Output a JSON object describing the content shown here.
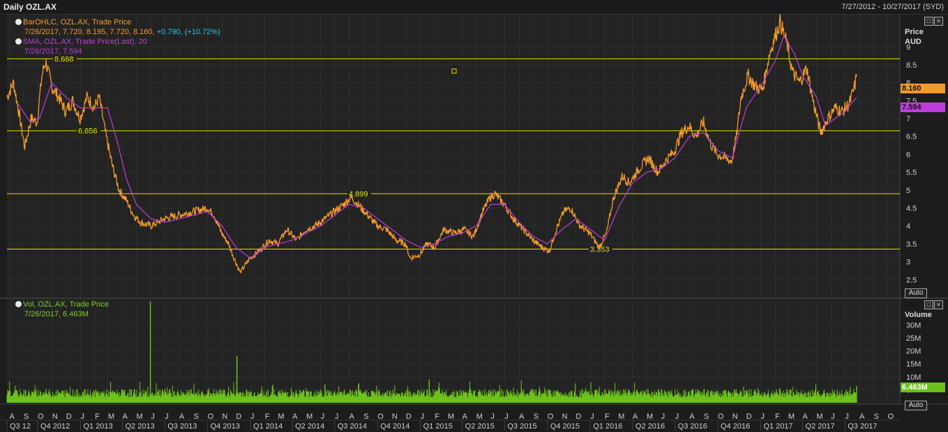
{
  "window": {
    "title": "Daily OZL.AX",
    "date_range": "7/27/2012 - 10/27/2017 (SYD)"
  },
  "price_pane": {
    "legend_bar_label": "BarOHLC, OZL.AX, Trade Price",
    "legend_bar_values": "7/26/2017, 7.720, 8.195, 7.720, 8.160,",
    "legend_bar_change": "+0.790, (+10.72%)",
    "legend_sma_label": "SMA, OZL.AX, Trade Price(Last),  20",
    "legend_sma_values": "7/26/2017, 7.594",
    "axis_title": "Price",
    "axis_unit": "AUD",
    "last_price_label": "8.160",
    "last_sma_label": "7.594",
    "auto_label": "Auto",
    "colors": {
      "price": "#f39a2b",
      "sma": "#c03cdc",
      "hline": "#e4e400",
      "price_tag": "#f39a2b",
      "sma_tag": "#c03cdc"
    }
  },
  "volume_pane": {
    "legend_label": "Vol, OZL.AX, Trade Price",
    "legend_values": "7/26/2017, 6.463M",
    "axis_title": "Volume",
    "last_volume_label": "6.463M",
    "auto_label": "Auto",
    "colors": {
      "volume": "#6cc21b",
      "volume_tag": "#6cc21b"
    }
  },
  "chart_data": [
    {
      "type": "line",
      "y_unit": "AUD",
      "ylim": [
        2.0,
        9.9
      ],
      "y_ticks": [
        "2.5",
        "3",
        "3.5",
        "4",
        "4.5",
        "5",
        "5.5",
        "6",
        "6.5",
        "7",
        "7.5",
        "8",
        "8.5",
        "9"
      ],
      "grid": true,
      "horizontal_levels": [
        {
          "value": 8.668,
          "label": "8.668"
        },
        {
          "value": 6.656,
          "label": "6.656"
        },
        {
          "value": 4.899,
          "label": "4.899"
        },
        {
          "value": 3.353,
          "label": "3.353"
        }
      ],
      "series": [
        {
          "name": "BarOHLC, OZL.AX, Trade Price",
          "points": [
            [
              "2012-07-27",
              7.6
            ],
            [
              "2012-08-10",
              8.0
            ],
            [
              "2012-08-20",
              7.3
            ],
            [
              "2012-09-03",
              6.2
            ],
            [
              "2012-09-17",
              7.0
            ],
            [
              "2012-09-30",
              6.9
            ],
            [
              "2012-10-10",
              8.2
            ],
            [
              "2012-10-18",
              8.6
            ],
            [
              "2012-10-31",
              7.9
            ],
            [
              "2012-11-15",
              7.6
            ],
            [
              "2012-11-30",
              7.2
            ],
            [
              "2012-12-15",
              7.5
            ],
            [
              "2012-12-31",
              7.0
            ],
            [
              "2013-01-15",
              7.6
            ],
            [
              "2013-01-31",
              7.3
            ],
            [
              "2013-02-10",
              7.6
            ],
            [
              "2013-02-25",
              6.5
            ],
            [
              "2013-03-10",
              5.7
            ],
            [
              "2013-03-25",
              5.0
            ],
            [
              "2013-04-10",
              4.7
            ],
            [
              "2013-04-25",
              4.3
            ],
            [
              "2013-05-10",
              4.1
            ],
            [
              "2013-06-01",
              4.0
            ],
            [
              "2013-06-30",
              4.2
            ],
            [
              "2013-07-31",
              4.3
            ],
            [
              "2013-08-31",
              4.4
            ],
            [
              "2013-09-30",
              4.5
            ],
            [
              "2013-10-15",
              4.3
            ],
            [
              "2013-10-31",
              3.8
            ],
            [
              "2013-11-15",
              3.5
            ],
            [
              "2013-11-30",
              3.0
            ],
            [
              "2013-12-10",
              2.7
            ],
            [
              "2013-12-31",
              3.1
            ],
            [
              "2014-01-20",
              3.3
            ],
            [
              "2014-02-10",
              3.6
            ],
            [
              "2014-03-01",
              3.5
            ],
            [
              "2014-03-20",
              3.9
            ],
            [
              "2014-04-10",
              3.6
            ],
            [
              "2014-04-30",
              3.9
            ],
            [
              "2014-05-20",
              4.0
            ],
            [
              "2014-06-10",
              4.2
            ],
            [
              "2014-06-30",
              4.4
            ],
            [
              "2014-07-20",
              4.6
            ],
            [
              "2014-08-05",
              4.8
            ],
            [
              "2014-08-20",
              4.6
            ],
            [
              "2014-09-10",
              4.3
            ],
            [
              "2014-09-30",
              4.0
            ],
            [
              "2014-10-20",
              3.9
            ],
            [
              "2014-11-10",
              3.6
            ],
            [
              "2014-11-30",
              3.5
            ],
            [
              "2014-12-10",
              3.1
            ],
            [
              "2014-12-31",
              3.2
            ],
            [
              "2015-01-15",
              3.5
            ],
            [
              "2015-02-01",
              3.4
            ],
            [
              "2015-02-20",
              3.9
            ],
            [
              "2015-03-15",
              3.8
            ],
            [
              "2015-04-05",
              3.9
            ],
            [
              "2015-04-25",
              3.7
            ],
            [
              "2015-05-15",
              4.4
            ],
            [
              "2015-05-31",
              4.8
            ],
            [
              "2015-06-10",
              4.9
            ],
            [
              "2015-06-30",
              4.6
            ],
            [
              "2015-07-20",
              4.2
            ],
            [
              "2015-08-10",
              3.9
            ],
            [
              "2015-08-31",
              3.6
            ],
            [
              "2015-09-20",
              3.4
            ],
            [
              "2015-10-05",
              3.3
            ],
            [
              "2015-10-20",
              3.9
            ],
            [
              "2015-11-05",
              4.4
            ],
            [
              "2015-11-20",
              4.5
            ],
            [
              "2015-12-10",
              4.0
            ],
            [
              "2015-12-31",
              3.8
            ],
            [
              "2016-01-20",
              3.4
            ],
            [
              "2016-02-05",
              3.8
            ],
            [
              "2016-02-20",
              4.8
            ],
            [
              "2016-03-10",
              5.4
            ],
            [
              "2016-03-25",
              5.2
            ],
            [
              "2016-04-15",
              5.6
            ],
            [
              "2016-05-05",
              5.9
            ],
            [
              "2016-05-25",
              5.5
            ],
            [
              "2016-06-10",
              5.8
            ],
            [
              "2016-06-30",
              6.1
            ],
            [
              "2016-07-15",
              6.6
            ],
            [
              "2016-07-31",
              6.8
            ],
            [
              "2016-08-15",
              6.5
            ],
            [
              "2016-08-31",
              6.9
            ],
            [
              "2016-09-15",
              6.3
            ],
            [
              "2016-09-30",
              6.0
            ],
            [
              "2016-10-15",
              5.9
            ],
            [
              "2016-10-31",
              5.8
            ],
            [
              "2016-11-10",
              6.5
            ],
            [
              "2016-11-20",
              7.6
            ],
            [
              "2016-12-05",
              8.2
            ],
            [
              "2016-12-20",
              7.9
            ],
            [
              "2017-01-05",
              7.8
            ],
            [
              "2017-01-20",
              8.8
            ],
            [
              "2017-02-01",
              9.3
            ],
            [
              "2017-02-12",
              9.7
            ],
            [
              "2017-02-28",
              9.0
            ],
            [
              "2017-03-10",
              8.3
            ],
            [
              "2017-03-25",
              8.0
            ],
            [
              "2017-04-10",
              8.4
            ],
            [
              "2017-04-25",
              7.4
            ],
            [
              "2017-05-10",
              6.6
            ],
            [
              "2017-05-25",
              7.0
            ],
            [
              "2017-06-10",
              7.3
            ],
            [
              "2017-06-25",
              7.2
            ],
            [
              "2017-07-10",
              7.4
            ],
            [
              "2017-07-20",
              7.8
            ],
            [
              "2017-07-26",
              8.16
            ]
          ]
        },
        {
          "name": "SMA, OZL.AX, Trade Price(Last),  20",
          "points": [
            [
              "2012-08-20",
              7.4
            ],
            [
              "2012-09-15",
              6.9
            ],
            [
              "2012-10-05",
              7.0
            ],
            [
              "2012-10-31",
              8.0
            ],
            [
              "2012-11-30",
              7.6
            ],
            [
              "2012-12-31",
              7.3
            ],
            [
              "2013-01-31",
              7.3
            ],
            [
              "2013-02-28",
              7.3
            ],
            [
              "2013-03-20",
              6.4
            ],
            [
              "2013-04-10",
              5.3
            ],
            [
              "2013-05-01",
              4.6
            ],
            [
              "2013-06-01",
              4.2
            ],
            [
              "2013-07-01",
              4.1
            ],
            [
              "2013-08-01",
              4.2
            ],
            [
              "2013-09-01",
              4.3
            ],
            [
              "2013-10-01",
              4.4
            ],
            [
              "2013-11-01",
              4.0
            ],
            [
              "2013-12-01",
              3.4
            ],
            [
              "2014-01-01",
              3.1
            ],
            [
              "2014-02-01",
              3.4
            ],
            [
              "2014-03-01",
              3.5
            ],
            [
              "2014-04-01",
              3.6
            ],
            [
              "2014-05-01",
              3.8
            ],
            [
              "2014-06-01",
              4.0
            ],
            [
              "2014-07-01",
              4.3
            ],
            [
              "2014-08-01",
              4.6
            ],
            [
              "2014-09-01",
              4.5
            ],
            [
              "2014-10-01",
              4.2
            ],
            [
              "2014-11-01",
              3.9
            ],
            [
              "2014-12-01",
              3.6
            ],
            [
              "2015-01-01",
              3.4
            ],
            [
              "2015-02-01",
              3.5
            ],
            [
              "2015-03-01",
              3.7
            ],
            [
              "2015-04-01",
              3.8
            ],
            [
              "2015-05-01",
              4.0
            ],
            [
              "2015-06-01",
              4.6
            ],
            [
              "2015-07-01",
              4.6
            ],
            [
              "2015-08-01",
              4.1
            ],
            [
              "2015-09-01",
              3.7
            ],
            [
              "2015-10-01",
              3.5
            ],
            [
              "2015-11-01",
              3.9
            ],
            [
              "2015-12-01",
              4.2
            ],
            [
              "2016-01-01",
              3.9
            ],
            [
              "2016-02-01",
              3.6
            ],
            [
              "2016-03-01",
              4.5
            ],
            [
              "2016-04-01",
              5.2
            ],
            [
              "2016-05-01",
              5.5
            ],
            [
              "2016-06-01",
              5.6
            ],
            [
              "2016-07-01",
              5.9
            ],
            [
              "2016-08-01",
              6.5
            ],
            [
              "2016-09-01",
              6.6
            ],
            [
              "2016-10-01",
              6.1
            ],
            [
              "2016-11-01",
              5.9
            ],
            [
              "2016-12-01",
              7.3
            ],
            [
              "2017-01-01",
              7.9
            ],
            [
              "2017-02-01",
              8.6
            ],
            [
              "2017-02-20",
              9.3
            ],
            [
              "2017-03-15",
              8.8
            ],
            [
              "2017-04-01",
              8.2
            ],
            [
              "2017-05-01",
              7.6
            ],
            [
              "2017-05-20",
              6.8
            ],
            [
              "2017-06-10",
              7.0
            ],
            [
              "2017-07-01",
              7.2
            ],
            [
              "2017-07-26",
              7.594
            ]
          ]
        }
      ]
    },
    {
      "type": "bar",
      "y_ticks": [
        "5M",
        "10M",
        "15M",
        "20M",
        "25M",
        "30M"
      ],
      "ylim": [
        0,
        40
      ],
      "y_unit": "M",
      "series": [
        {
          "name": "Vol, OZL.AX, Trade Price",
          "spikes": [
            [
              "2013-05-31",
              39
            ],
            [
              "2013-12-03",
              18
            ],
            [
              "2015-01-20",
              9
            ],
            [
              "2014-06-10",
              7
            ]
          ],
          "typical": 3.5,
          "last": 6.463
        }
      ]
    }
  ],
  "x_axis": {
    "months": [
      "A",
      "S",
      "O",
      "N",
      "D",
      "J",
      "F",
      "M",
      "A",
      "M",
      "J",
      "J",
      "A",
      "S",
      "O",
      "N",
      "D",
      "J",
      "F",
      "M",
      "A",
      "M",
      "J",
      "J",
      "A",
      "S",
      "O",
      "N",
      "D",
      "J",
      "F",
      "M",
      "A",
      "M",
      "J",
      "J",
      "A",
      "S",
      "O",
      "N",
      "D",
      "J",
      "F",
      "M",
      "A",
      "M",
      "J",
      "J",
      "A",
      "S",
      "O",
      "N",
      "D",
      "J",
      "F",
      "M",
      "A",
      "M",
      "J",
      "J",
      "A",
      "S",
      "O"
    ],
    "quarters": [
      "Q3 12",
      "Q4 2012",
      "Q1 2013",
      "Q2 2013",
      "Q3 2013",
      "Q4 2013",
      "Q1 2014",
      "Q2 2014",
      "Q3 2014",
      "Q4 2014",
      "Q1 2015",
      "Q2 2015",
      "Q3 2015",
      "Q4 2015",
      "Q1 2016",
      "Q2 2016",
      "Q3 2016",
      "Q4 2016",
      "Q1 2017",
      "Q2 2017",
      "Q3 2017"
    ]
  }
}
